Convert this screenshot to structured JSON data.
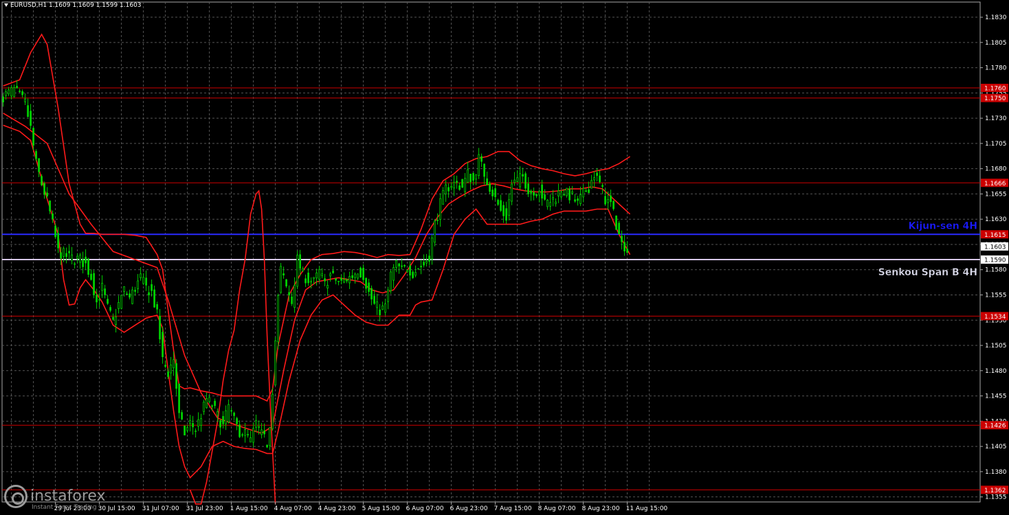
{
  "chart_title": "EURUSD,H1  1.1609 1.1609 1.1599 1.1603",
  "watermark": {
    "brand": "instaforex",
    "tagline": "Instant Forex Trading"
  },
  "colors": {
    "background": "#000000",
    "grid": "#555555",
    "candles": "#00d000",
    "ichimoku": "#ff1a1a",
    "level": "#cc0000",
    "kijun": "#2a2aff",
    "senkou": "#d8c8e8",
    "axis_text": "#ffffff"
  },
  "chart_data": {
    "type": "line",
    "symbol": "EURUSD",
    "timeframe": "H1",
    "ohlc_header": {
      "open": 1.1609,
      "high": 1.1609,
      "low": 1.1599,
      "close": 1.1603
    },
    "current_price": "1.1603",
    "ylim": [
      1.135,
      1.1845
    ],
    "y_ticks": [
      "1.1830",
      "1.1805",
      "1.1780",
      "1.1755",
      "1.1730",
      "1.1705",
      "1.1680",
      "1.1655",
      "1.1630",
      "1.1605",
      "1.1580",
      "1.1555",
      "1.1530",
      "1.1505",
      "1.1480",
      "1.1455",
      "1.1430",
      "1.1405",
      "1.1380",
      "1.1355"
    ],
    "x_ticks": [
      {
        "label": "29 Jul 23:00",
        "bar": 19
      },
      {
        "label": "30 Jul 15:00",
        "bar": 35
      },
      {
        "label": "31 Jul 07:00",
        "bar": 51
      },
      {
        "label": "31 Jul 23:00",
        "bar": 67
      },
      {
        "label": "1 Aug 15:00",
        "bar": 83
      },
      {
        "label": "4 Aug 07:00",
        "bar": 99
      },
      {
        "label": "4 Aug 23:00",
        "bar": 115
      },
      {
        "label": "5 Aug 15:00",
        "bar": 131
      },
      {
        "label": "6 Aug 07:00",
        "bar": 147
      },
      {
        "label": "6 Aug 23:00",
        "bar": 163
      },
      {
        "label": "7 Aug 15:00",
        "bar": 179
      },
      {
        "label": "8 Aug 07:00",
        "bar": 195
      },
      {
        "label": "8 Aug 23:00",
        "bar": 211
      },
      {
        "label": "11 Aug 15:00",
        "bar": 227
      }
    ],
    "levels": [
      {
        "price": 1.176,
        "label": "1.1760",
        "kind": "red"
      },
      {
        "price": 1.175,
        "label": "1.1750",
        "kind": "red"
      },
      {
        "price": 1.1666,
        "label": "1.1666",
        "kind": "red"
      },
      {
        "price": 1.1534,
        "label": "1.1534",
        "kind": "red"
      },
      {
        "price": 1.1426,
        "label": "1.1426",
        "kind": "red"
      },
      {
        "price": 1.1362,
        "label": "1.1362",
        "kind": "red"
      },
      {
        "price": 1.1615,
        "label": "1.1615",
        "kind": "kijun",
        "name": "Kijun-sen 4H"
      },
      {
        "price": 1.159,
        "label": "1.1590",
        "kind": "senkou",
        "name": "Senkou Span B 4H"
      }
    ],
    "close_path": [
      [
        0,
        1.1752
      ],
      [
        4,
        1.1758
      ],
      [
        8,
        1.1745
      ],
      [
        10,
        1.172
      ],
      [
        12,
        1.1685
      ],
      [
        14,
        1.1665
      ],
      [
        16,
        1.1648
      ],
      [
        18,
        1.1625
      ],
      [
        20,
        1.1598
      ],
      [
        24,
        1.1592
      ],
      [
        28,
        1.159
      ],
      [
        30,
        1.1585
      ],
      [
        32,
        1.1573
      ],
      [
        34,
        1.1548
      ],
      [
        36,
        1.1562
      ],
      [
        38,
        1.1542
      ],
      [
        40,
        1.1528
      ],
      [
        42,
        1.1546
      ],
      [
        44,
        1.156
      ],
      [
        46,
        1.1552
      ],
      [
        48,
        1.1562
      ],
      [
        50,
        1.1572
      ],
      [
        52,
        1.1562
      ],
      [
        54,
        1.1558
      ],
      [
        56,
        1.1535
      ],
      [
        58,
        1.149
      ],
      [
        60,
        1.1478
      ],
      [
        62,
        1.1492
      ],
      [
        64,
        1.1435
      ],
      [
        66,
        1.1418
      ],
      [
        68,
        1.1428
      ],
      [
        70,
        1.1422
      ],
      [
        72,
        1.1436
      ],
      [
        74,
        1.1452
      ],
      [
        76,
        1.1446
      ],
      [
        78,
        1.1435
      ],
      [
        80,
        1.1425
      ],
      [
        82,
        1.1445
      ],
      [
        84,
        1.143
      ],
      [
        86,
        1.142
      ],
      [
        88,
        1.1418
      ],
      [
        90,
        1.141
      ],
      [
        92,
        1.1428
      ],
      [
        94,
        1.1416
      ],
      [
        96,
        1.1408
      ],
      [
        97,
        1.1428
      ],
      [
        98,
        1.1462
      ],
      [
        99,
        1.151
      ],
      [
        100,
        1.1552
      ],
      [
        101,
        1.158
      ],
      [
        103,
        1.1562
      ],
      [
        105,
        1.1548
      ],
      [
        107,
        1.159
      ],
      [
        109,
        1.1575
      ],
      [
        111,
        1.157
      ],
      [
        113,
        1.1568
      ],
      [
        115,
        1.1578
      ],
      [
        117,
        1.1565
      ],
      [
        119,
        1.1575
      ],
      [
        121,
        1.157
      ],
      [
        123,
        1.1567
      ],
      [
        125,
        1.1571
      ],
      [
        127,
        1.1574
      ],
      [
        129,
        1.158
      ],
      [
        131,
        1.1575
      ],
      [
        133,
        1.1557
      ],
      [
        135,
        1.1545
      ],
      [
        137,
        1.154
      ],
      [
        139,
        1.1543
      ],
      [
        141,
        1.1575
      ],
      [
        143,
        1.1585
      ],
      [
        145,
        1.1579
      ],
      [
        147,
        1.1583
      ],
      [
        149,
        1.1577
      ],
      [
        151,
        1.1582
      ],
      [
        153,
        1.1585
      ],
      [
        155,
        1.1594
      ],
      [
        157,
        1.1625
      ],
      [
        159,
        1.1645
      ],
      [
        161,
        1.166
      ],
      [
        163,
        1.1665
      ],
      [
        165,
        1.1665
      ],
      [
        167,
        1.1662
      ],
      [
        169,
        1.1675
      ],
      [
        171,
        1.1668
      ],
      [
        173,
        1.169
      ],
      [
        175,
        1.1675
      ],
      [
        177,
        1.1662
      ],
      [
        179,
        1.165
      ],
      [
        181,
        1.1638
      ],
      [
        183,
        1.1632
      ],
      [
        185,
        1.1665
      ],
      [
        187,
        1.1668
      ],
      [
        189,
        1.1672
      ],
      [
        191,
        1.166
      ],
      [
        193,
        1.1655
      ],
      [
        195,
        1.1662
      ],
      [
        197,
        1.1645
      ],
      [
        199,
        1.1648
      ],
      [
        201,
        1.1652
      ],
      [
        203,
        1.166
      ],
      [
        205,
        1.1655
      ],
      [
        207,
        1.1652
      ],
      [
        209,
        1.1645
      ],
      [
        211,
        1.1655
      ],
      [
        213,
        1.1662
      ],
      [
        215,
        1.1675
      ],
      [
        217,
        1.1665
      ],
      [
        219,
        1.165
      ],
      [
        221,
        1.1645
      ],
      [
        223,
        1.1625
      ],
      [
        225,
        1.1605
      ],
      [
        227,
        1.1603
      ]
    ],
    "ichimoku_upper": [
      [
        0,
        1.1762
      ],
      [
        6,
        1.1768
      ],
      [
        10,
        1.1795
      ],
      [
        14,
        1.1813
      ],
      [
        16,
        1.1803
      ],
      [
        20,
        1.174
      ],
      [
        24,
        1.1665
      ],
      [
        28,
        1.1625
      ],
      [
        30,
        1.1616
      ],
      [
        33,
        1.1616
      ],
      [
        36,
        1.1615
      ],
      [
        40,
        1.1615
      ],
      [
        44,
        1.1615
      ],
      [
        48,
        1.1614
      ],
      [
        52,
        1.1612
      ],
      [
        56,
        1.1595
      ],
      [
        58,
        1.158
      ],
      [
        60,
        1.154
      ],
      [
        62,
        1.15
      ],
      [
        64,
        1.1465
      ],
      [
        66,
        1.1462
      ],
      [
        68,
        1.1463
      ],
      [
        72,
        1.146
      ],
      [
        76,
        1.1458
      ],
      [
        80,
        1.1455
      ],
      [
        84,
        1.1455
      ],
      [
        88,
        1.1455
      ],
      [
        92,
        1.1455
      ],
      [
        96,
        1.145
      ],
      [
        98,
        1.1462
      ],
      [
        100,
        1.1505
      ],
      [
        104,
        1.1555
      ],
      [
        108,
        1.1575
      ],
      [
        112,
        1.159
      ],
      [
        116,
        1.1595
      ],
      [
        120,
        1.1596
      ],
      [
        124,
        1.1598
      ],
      [
        128,
        1.1597
      ],
      [
        132,
        1.1595
      ],
      [
        136,
        1.1592
      ],
      [
        140,
        1.1595
      ],
      [
        144,
        1.1594
      ],
      [
        148,
        1.1595
      ],
      [
        152,
        1.162
      ],
      [
        156,
        1.165
      ],
      [
        160,
        1.1668
      ],
      [
        164,
        1.1675
      ],
      [
        168,
        1.1685
      ],
      [
        172,
        1.169
      ],
      [
        176,
        1.1692
      ],
      [
        180,
        1.1697
      ],
      [
        184,
        1.1697
      ],
      [
        188,
        1.1688
      ],
      [
        192,
        1.1683
      ],
      [
        196,
        1.168
      ],
      [
        200,
        1.1678
      ],
      [
        204,
        1.1675
      ],
      [
        208,
        1.1673
      ],
      [
        212,
        1.1675
      ],
      [
        216,
        1.1678
      ],
      [
        220,
        1.168
      ],
      [
        224,
        1.1685
      ],
      [
        228,
        1.1692
      ]
    ],
    "ichimoku_lower": [
      [
        0,
        1.1723
      ],
      [
        6,
        1.1717
      ],
      [
        10,
        1.1708
      ],
      [
        14,
        1.167
      ],
      [
        16,
        1.165
      ],
      [
        20,
        1.1615
      ],
      [
        22,
        1.157
      ],
      [
        24,
        1.1545
      ],
      [
        26,
        1.1546
      ],
      [
        28,
        1.1562
      ],
      [
        30,
        1.157
      ],
      [
        33,
        1.156
      ],
      [
        36,
        1.1548
      ],
      [
        40,
        1.1525
      ],
      [
        44,
        1.1518
      ],
      [
        48,
        1.1525
      ],
      [
        52,
        1.1532
      ],
      [
        56,
        1.1535
      ],
      [
        58,
        1.1522
      ],
      [
        60,
        1.148
      ],
      [
        62,
        1.144
      ],
      [
        64,
        1.1405
      ],
      [
        66,
        1.1385
      ],
      [
        68,
        1.1374
      ],
      [
        72,
        1.1385
      ],
      [
        76,
        1.1405
      ],
      [
        80,
        1.141
      ],
      [
        84,
        1.1405
      ],
      [
        88,
        1.1403
      ],
      [
        92,
        1.1402
      ],
      [
        96,
        1.1398
      ],
      [
        98,
        1.1398
      ],
      [
        100,
        1.142
      ],
      [
        104,
        1.147
      ],
      [
        108,
        1.151
      ],
      [
        112,
        1.1535
      ],
      [
        116,
        1.155
      ],
      [
        120,
        1.1555
      ],
      [
        124,
        1.1545
      ],
      [
        128,
        1.1535
      ],
      [
        132,
        1.1528
      ],
      [
        136,
        1.1525
      ],
      [
        140,
        1.1525
      ],
      [
        144,
        1.1535
      ],
      [
        148,
        1.1535
      ],
      [
        150,
        1.1545
      ],
      [
        152,
        1.1548
      ],
      [
        156,
        1.155
      ],
      [
        160,
        1.158
      ],
      [
        164,
        1.1615
      ],
      [
        168,
        1.163
      ],
      [
        172,
        1.164
      ],
      [
        176,
        1.1625
      ],
      [
        180,
        1.1625
      ],
      [
        184,
        1.1625
      ],
      [
        188,
        1.1625
      ],
      [
        192,
        1.1628
      ],
      [
        196,
        1.163
      ],
      [
        200,
        1.1635
      ],
      [
        204,
        1.1638
      ],
      [
        208,
        1.1638
      ],
      [
        212,
        1.1638
      ],
      [
        216,
        1.164
      ],
      [
        220,
        1.164
      ],
      [
        224,
        1.1615
      ],
      [
        228,
        1.1595
      ]
    ],
    "ichimoku_cross": [
      [
        0,
        1.1735
      ],
      [
        8,
        1.1722
      ],
      [
        16,
        1.1705
      ],
      [
        24,
        1.1655
      ],
      [
        32,
        1.1625
      ],
      [
        40,
        1.1598
      ],
      [
        48,
        1.159
      ],
      [
        56,
        1.1582
      ],
      [
        60,
        1.155
      ],
      [
        66,
        1.1495
      ],
      [
        72,
        1.1458
      ],
      [
        78,
        1.1433
      ],
      [
        86,
        1.1425
      ],
      [
        94,
        1.1418
      ],
      [
        98,
        1.1425
      ],
      [
        102,
        1.148
      ],
      [
        106,
        1.153
      ],
      [
        110,
        1.156
      ],
      [
        114,
        1.1568
      ],
      [
        118,
        1.157
      ],
      [
        122,
        1.1572
      ],
      [
        126,
        1.157
      ],
      [
        130,
        1.1568
      ],
      [
        134,
        1.156
      ],
      [
        138,
        1.1557
      ],
      [
        142,
        1.156
      ],
      [
        146,
        1.1575
      ],
      [
        150,
        1.1592
      ],
      [
        154,
        1.1615
      ],
      [
        158,
        1.1632
      ],
      [
        162,
        1.1645
      ],
      [
        166,
        1.1652
      ],
      [
        170,
        1.1658
      ],
      [
        174,
        1.1663
      ],
      [
        178,
        1.1665
      ],
      [
        182,
        1.1663
      ],
      [
        186,
        1.166
      ],
      [
        190,
        1.1658
      ],
      [
        194,
        1.1657
      ],
      [
        198,
        1.1657
      ],
      [
        202,
        1.1658
      ],
      [
        206,
        1.166
      ],
      [
        210,
        1.166
      ],
      [
        214,
        1.1662
      ],
      [
        218,
        1.166
      ],
      [
        222,
        1.165
      ],
      [
        226,
        1.164
      ],
      [
        228,
        1.1635
      ]
    ],
    "ichimoku_wide": [
      [
        68,
        1.1362
      ],
      [
        70,
        1.1348
      ],
      [
        72,
        1.1348
      ],
      [
        74,
        1.137
      ],
      [
        76,
        1.14
      ],
      [
        78,
        1.143
      ],
      [
        80,
        1.147
      ],
      [
        82,
        1.15
      ],
      [
        84,
        1.152
      ],
      [
        86,
        1.156
      ],
      [
        88,
        1.159
      ],
      [
        90,
        1.1635
      ],
      [
        92,
        1.1655
      ],
      [
        93,
        1.1658
      ],
      [
        94,
        1.164
      ],
      [
        95,
        1.159
      ],
      [
        96,
        1.1515
      ],
      [
        97,
        1.1455
      ],
      [
        98,
        1.14
      ],
      [
        99,
        1.1348
      ]
    ]
  }
}
